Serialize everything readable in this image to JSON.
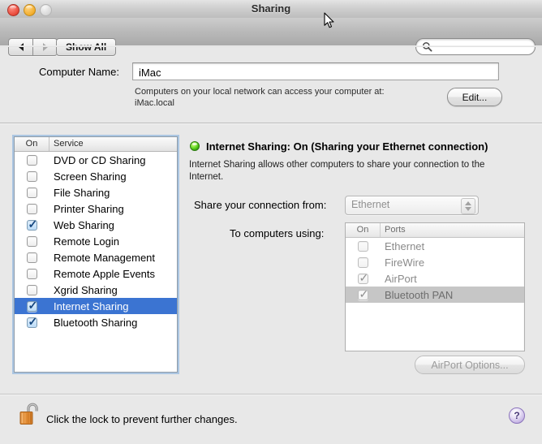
{
  "window": {
    "title": "Sharing",
    "traffic_lights": [
      "close",
      "minimize",
      "zoom"
    ]
  },
  "toolbar": {
    "back_label": "",
    "forward_label": "",
    "show_all_label": "Show All",
    "search_value": "",
    "search_placeholder": ""
  },
  "computer_name": {
    "label": "Computer Name:",
    "value": "iMac",
    "placeholder": "",
    "help_line1": "Computers on your local network can access your computer at:",
    "help_line2": "iMac.local",
    "edit_label": "Edit..."
  },
  "services": {
    "header_on": "On",
    "header_service": "Service",
    "rows": [
      {
        "label": "DVD or CD Sharing",
        "checked": false,
        "selected": false
      },
      {
        "label": "Screen Sharing",
        "checked": false,
        "selected": false
      },
      {
        "label": "File Sharing",
        "checked": false,
        "selected": false
      },
      {
        "label": "Printer Sharing",
        "checked": false,
        "selected": false
      },
      {
        "label": "Web Sharing",
        "checked": true,
        "selected": false
      },
      {
        "label": "Remote Login",
        "checked": false,
        "selected": false
      },
      {
        "label": "Remote Management",
        "checked": false,
        "selected": false
      },
      {
        "label": "Remote Apple Events",
        "checked": false,
        "selected": false
      },
      {
        "label": "Xgrid Sharing",
        "checked": false,
        "selected": false
      },
      {
        "label": "Internet Sharing",
        "checked": true,
        "selected": true
      },
      {
        "label": "Bluetooth Sharing",
        "checked": true,
        "selected": false
      }
    ]
  },
  "detail": {
    "status_title": "Internet Sharing: On (Sharing your Ethernet connection)",
    "status_state": "On",
    "status_color": "#5ecf1f",
    "description": "Internet Sharing allows other computers to share your connection to the Internet.",
    "share_from_label": "Share your connection from:",
    "share_from_value": "Ethernet",
    "to_computers_label": "To computers using:",
    "airport_options_label": "AirPort Options..."
  },
  "ports": {
    "header_on": "On",
    "header_ports": "Ports",
    "rows": [
      {
        "label": "Ethernet",
        "checked": false,
        "selected": false
      },
      {
        "label": "FireWire",
        "checked": false,
        "selected": false
      },
      {
        "label": "AirPort",
        "checked": true,
        "selected": false
      },
      {
        "label": "Bluetooth PAN",
        "checked": true,
        "selected": true
      }
    ]
  },
  "footer": {
    "lock_text": "Click the lock to prevent further changes.",
    "lock_state": "unlocked",
    "help_label": "?"
  },
  "colors": {
    "selection_blue": "#3b74d2",
    "selection_gray": "#c6c6c6",
    "status_green": "#5ecf1f",
    "window_bg": "#e8e8e8"
  }
}
